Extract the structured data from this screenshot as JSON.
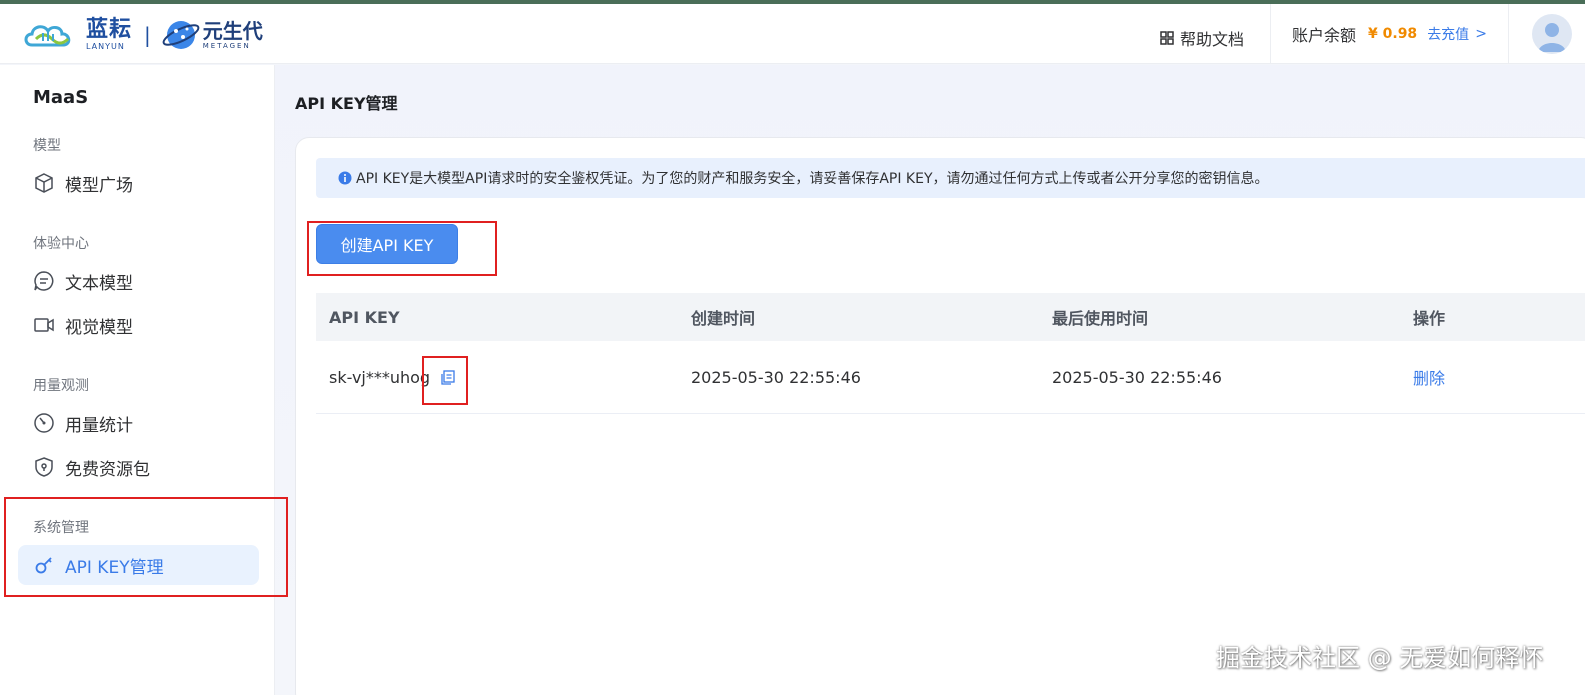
{
  "header": {
    "logo_brand_cn": "蓝耘",
    "logo_brand_en": "LANYUN",
    "logo_separator": "|",
    "logo_partner_cn": "元生代",
    "logo_partner_en": "METAGEN",
    "help_label": "帮助文档",
    "balance_label": "账户余额",
    "balance_amount": "¥ 0.98",
    "recharge_label": "去充值",
    "recharge_chevron": ">"
  },
  "sidebar": {
    "title": "MaaS",
    "groups": [
      {
        "label": "模型",
        "items": [
          {
            "label": "模型广场",
            "icon": "cube-icon"
          }
        ]
      },
      {
        "label": "体验中心",
        "items": [
          {
            "label": "文本模型",
            "icon": "chat-icon"
          },
          {
            "label": "视觉模型",
            "icon": "video-icon"
          }
        ]
      },
      {
        "label": "用量观测",
        "items": [
          {
            "label": "用量统计",
            "icon": "gauge-icon"
          },
          {
            "label": "免费资源包",
            "icon": "shield-icon"
          }
        ]
      },
      {
        "label": "系统管理",
        "items": [
          {
            "label": "API KEY管理",
            "icon": "key-icon",
            "active": true
          }
        ]
      }
    ]
  },
  "main": {
    "page_title": "API KEY管理",
    "notice": "API KEY是大模型API请求时的安全鉴权凭证。为了您的财产和服务安全，请妥善保存API KEY，请勿通过任何方式上传或者公开分享您的密钥信息。",
    "create_button": "创建API KEY",
    "table": {
      "headers": [
        "API KEY",
        "创建时间",
        "最后使用时间",
        "操作"
      ],
      "rows": [
        {
          "api_key": "sk-vj***uhog",
          "created": "2025-05-30 22:55:46",
          "last_used": "2025-05-30 22:55:46",
          "action": "删除"
        }
      ]
    }
  },
  "watermark": "掘金技术社区 @ 无爱如何释怀",
  "colors": {
    "accent": "#3a7be8",
    "button": "#4a8cef",
    "amount": "#f08a00",
    "highlight_box": "#e02020"
  }
}
